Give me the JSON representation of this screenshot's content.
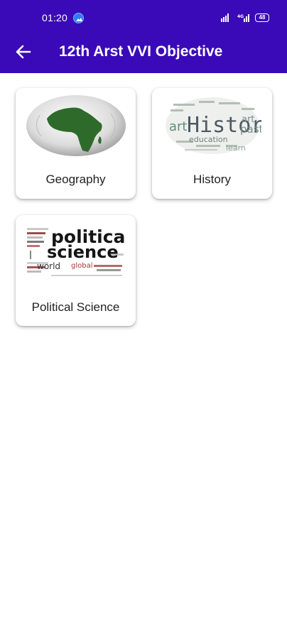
{
  "status": {
    "time": "01:20",
    "battery": "48"
  },
  "appbar": {
    "title": "12th Arst VVI Objective",
    "back_icon": "arrow-left-icon"
  },
  "colors": {
    "appbar": "#3a0ab8",
    "accent_green": "#2e6b2a"
  },
  "subjects": [
    {
      "label": "Geography",
      "image": "africa-globe"
    },
    {
      "label": "History",
      "image": "history-word-cloud",
      "art_words": [
        "History",
        "art",
        "past",
        "education",
        "learn"
      ]
    },
    {
      "label": "Political Science",
      "image": "political-science-word-cloud",
      "art_words": [
        "political",
        "science",
        "world",
        "global"
      ]
    }
  ]
}
